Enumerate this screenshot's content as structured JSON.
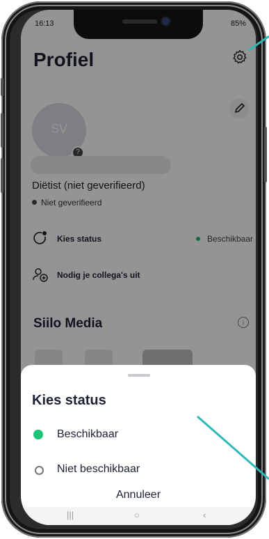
{
  "status_bar": {
    "time": "16:13",
    "battery": "85%"
  },
  "profile": {
    "title": "Profiel",
    "avatar_initials": "SV",
    "avatar_badge": "?",
    "profession": "Diëtist (niet geverifieerd)",
    "verification": "Niet geverifieerd",
    "status_row": {
      "label": "Kies status",
      "value": "Beschikbaar"
    },
    "invite_row": {
      "label": "Nodig je collega's uit"
    },
    "section_title": "Siilo Media",
    "info_glyph": "i"
  },
  "sheet": {
    "title": "Kies status",
    "options": [
      {
        "label": "Beschikbaar",
        "selected": true,
        "color": "#1cc47a"
      },
      {
        "label": "Niet beschikbaar",
        "selected": false,
        "color": "#777777"
      }
    ],
    "cancel_label": "Annuleer"
  },
  "colors": {
    "accent_green": "#1cc47a",
    "annotation_teal": "#2fb8b8",
    "text_dark": "#1c2233"
  }
}
